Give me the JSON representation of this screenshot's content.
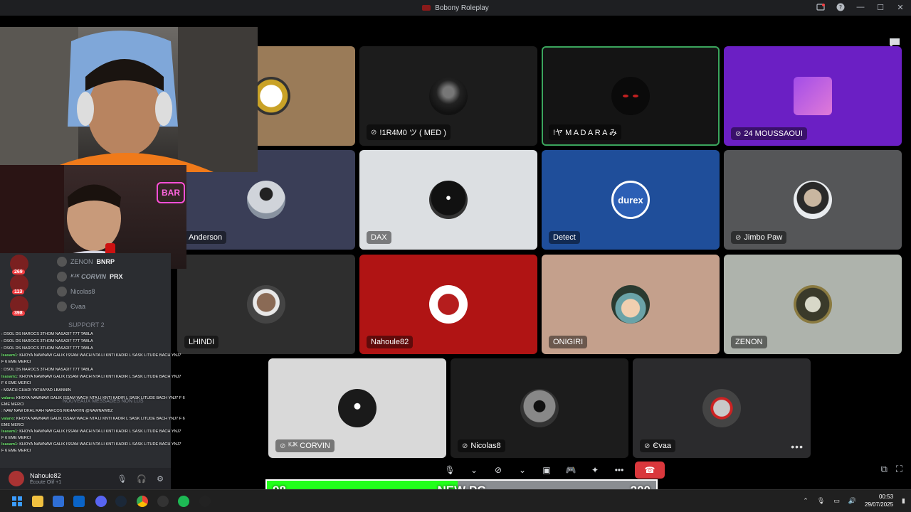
{
  "window": {
    "title": "Bobony Roleplay"
  },
  "participants": [
    {
      "id": "p1",
      "name": "",
      "muted": false
    },
    {
      "id": "p2",
      "name": "!1R4M0 ツ ( MED )",
      "muted": true
    },
    {
      "id": "p3",
      "name": "!ヤ M A D A R A み",
      "muted": false,
      "speaking": true
    },
    {
      "id": "p4",
      "name": "24 MOUSSAOUI",
      "muted": true
    },
    {
      "id": "p5",
      "name": "Anderson",
      "muted": false
    },
    {
      "id": "p6",
      "name": "DAX",
      "muted": false
    },
    {
      "id": "p7",
      "name": "Detect",
      "muted": false,
      "avatar_text": "durex"
    },
    {
      "id": "p8",
      "name": "Jimbo Paw",
      "muted": true
    },
    {
      "id": "p9",
      "name": "LHINDI",
      "muted": false
    },
    {
      "id": "p10",
      "name": "Nahoule82",
      "muted": false
    },
    {
      "id": "p11",
      "name": "ONIGIRI",
      "muted": false
    },
    {
      "id": "p12",
      "name": "ZENON",
      "muted": false
    },
    {
      "id": "p13",
      "name": "ᴷᴶᴷ CORVIN",
      "muted": true
    },
    {
      "id": "p14",
      "name": "Nicolas8",
      "muted": true
    },
    {
      "id": "p15",
      "name": "Єvaa",
      "muted": true
    }
  ],
  "sidebar": {
    "members": [
      {
        "name": "ZENON",
        "tag": "BNRP"
      },
      {
        "name": "ᴷᴶᴷ CORVIN",
        "tag": "PRX"
      },
      {
        "name": "Nicolas8",
        "tag": ""
      },
      {
        "name": "Єvaa",
        "tag": ""
      }
    ],
    "badges": [
      "269",
      "113",
      "398"
    ],
    "channel_support2": "SUPPORT 2",
    "channel_new": "NOUVEAUX MESSAGES NON LUS",
    "chat_lines": [
      {
        "user": "",
        "text": ": DSOL DS NAROCS 3THOM NASA2I7 T7T TABLA"
      },
      {
        "user": "",
        "text": ": DSOL DS NAROCS 3THOM NASA2I7 T7T TABLA"
      },
      {
        "user": "",
        "text": ": DSOL DS NAROCS 3THOM NASA2I7 T7T TABLA"
      },
      {
        "user": "lsasam1",
        "text": ": KHOYA NAWNAW GALIK ISSAM WACH NTA LI KNTI KADIR L SASK LITUDE BACH YNJ7"
      },
      {
        "user": "",
        "text": "F 6 EME MERCI"
      },
      {
        "user": "",
        "text": ": DSOL DS NAROCS 3THOM NASA2I7 T7T TABLA"
      },
      {
        "user": "lsasam1",
        "text": ": KHOYA NAWNAW GALIK ISSAM WACH NTA LI KNTI KADIR L SASK LITUDE BACH YNJ7"
      },
      {
        "user": "",
        "text": "F 6 EME MERCI"
      },
      {
        "user": "",
        "text": ": M3ACH GHADI YATHAYAD LBANNIN"
      },
      {
        "user": "valano",
        "text": ": KHOYA NAWNAW GALIK ISSAM WACH NTA LI KNTI KADIR L SASK LITUDE BACH YNJ7 F 6"
      },
      {
        "user": "",
        "text": "EME MERCI"
      },
      {
        "user": "",
        "text": ": NAW NAW DKHL RAH NARCOS MKHARYIN @NAWNAWBZ"
      },
      {
        "user": "valano",
        "text": ": KHOYA NAWNAW GALIK ISSAM WACH NTA LI KNTI KADIR L SASK LITUDE BACH YNJ7 F 6"
      },
      {
        "user": "",
        "text": "EME MERCI"
      },
      {
        "user": "lsasam1",
        "text": ": KHOYA NAWNAW GALIK ISSAM WACH NTA LI KNTI KADIR L SASK LITUDE BACH YNJ7"
      },
      {
        "user": "",
        "text": "F 6 EME MERCI"
      },
      {
        "user": "lsasam1",
        "text": ": KHOYA NAWNAW GALIK ISSAM WACH NTA LI KNTI KADIR L SASK LITUDE BACH YNJ7"
      },
      {
        "user": "",
        "text": "F 6 EME MERCI"
      }
    ],
    "user": {
      "name": "Nahoule82",
      "status": "Écoute Olif +1"
    }
  },
  "webcam": {
    "sign_text": "BAR"
  },
  "goal": {
    "current": "98",
    "label": "NEW PC",
    "target": "200",
    "progress": 0.49,
    "fill_color": "#22ff1a"
  },
  "clock": {
    "time": "00:53",
    "date": "29/07/2025"
  },
  "colors": {
    "speaking": "#3ba55d",
    "hangup": "#da373c"
  }
}
